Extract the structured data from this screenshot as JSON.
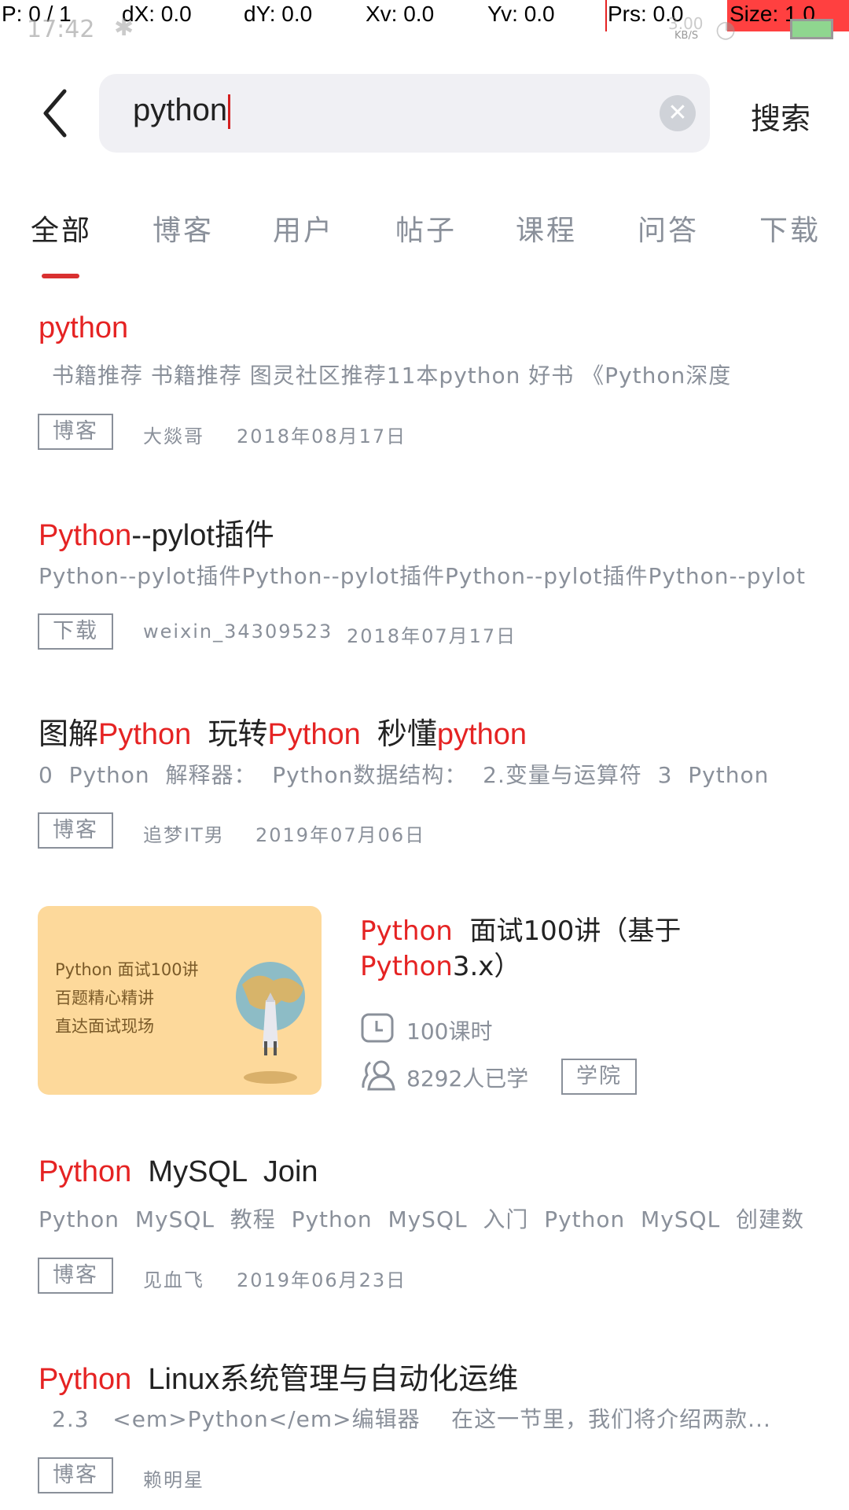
{
  "debug_overlay": {
    "p": "P: 0 / 1",
    "dx": "dX: 0.0",
    "dy": "dY: 0.0",
    "xv": "Xv: 0.0",
    "yv": "Yv: 0.0",
    "prs": "Prs: 0.0",
    "size": "Size: 1.0"
  },
  "status_bar": {
    "time": "17:42",
    "net_speed": "3.00",
    "net_unit": "KB/S"
  },
  "search": {
    "value": "python",
    "button": "搜索"
  },
  "tabs": [
    "全部",
    "博客",
    "用户",
    "帖子",
    "课程",
    "问答",
    "下载"
  ],
  "active_tab": 0,
  "colors": {
    "accent": "#e52323",
    "muted": "#8a909a"
  },
  "results": [
    {
      "title": [
        {
          "t": "python",
          "hl": true
        }
      ],
      "snippet": "书籍推荐  书籍推荐  图灵社区推荐11本python  好书  《Python深度",
      "tag": "博客",
      "author": "大燚哥",
      "date": "2018年08月17日"
    },
    {
      "title": [
        {
          "t": "Python",
          "hl": true
        },
        {
          "t": "--pylot插件",
          "hl": false
        }
      ],
      "snippet": "Python--pylot插件Python--pylot插件Python--pylot插件Python--pylot",
      "tag": "下载",
      "author": "weixin_34309523",
      "date": "2018年07月17日"
    },
    {
      "title": [
        {
          "t": "图解",
          "hl": false
        },
        {
          "t": "Python",
          "hl": true
        },
        {
          "t": "  玩转",
          "hl": false
        },
        {
          "t": "Python",
          "hl": true
        },
        {
          "t": "  秒懂",
          "hl": false
        },
        {
          "t": "python",
          "hl": true
        }
      ],
      "snippet": "0  Python  解释器：  Python数据结构：  2.变量与运算符  3  Python",
      "tag": "博客",
      "author": "追梦IT男",
      "date": "2019年07月06日"
    },
    {
      "title": [
        {
          "t": "Python",
          "hl": true
        },
        {
          "t": "  MySQL  Join",
          "hl": false
        }
      ],
      "snippet": "Python  MySQL  教程  Python  MySQL  入门  Python  MySQL  创建数",
      "tag": "博客",
      "author": "见血飞",
      "date": "2019年06月23日"
    },
    {
      "title": [
        {
          "t": "Python",
          "hl": true
        },
        {
          "t": "  Linux系统管理与自动化运维",
          "hl": false
        }
      ],
      "snippet": "2.3   <em>Python</em>编辑器    在这一节里，我们将介绍两款...",
      "tag": "博客",
      "author": "赖明星"
    }
  ],
  "course": {
    "image_text": [
      "Python 面试100讲",
      "百题精心精讲",
      "直达面试现场"
    ],
    "title_line1": [
      {
        "t": "Python",
        "hl": true
      },
      {
        "t": "  面试100讲（基于",
        "hl": false
      }
    ],
    "title_line2": [
      {
        "t": "Python",
        "hl": true
      },
      {
        "t": "3.x）",
        "hl": false
      }
    ],
    "lessons": "100课时",
    "learners": "8292人已学",
    "tag": "学院"
  }
}
